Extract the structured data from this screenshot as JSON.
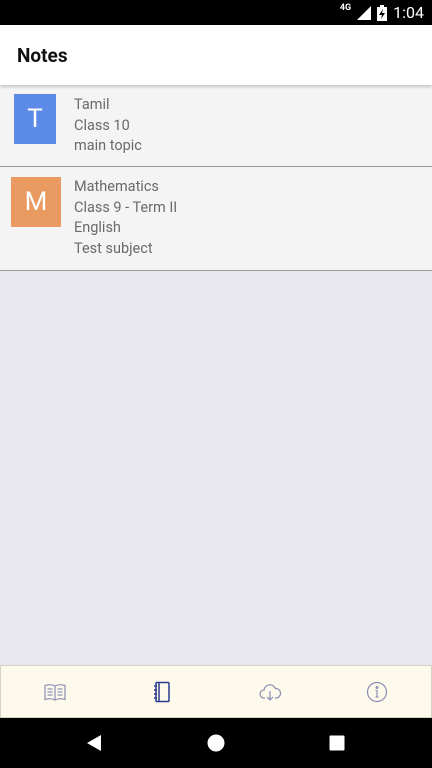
{
  "status_bar": {
    "network": "4G",
    "time": "1:04"
  },
  "app_bar": {
    "title": "Notes"
  },
  "notes": [
    {
      "initial": "T",
      "color": "#5b8be6",
      "lines": [
        "Tamil",
        "Class 10",
        "main topic"
      ]
    },
    {
      "initial": "M",
      "color": "#e89a60",
      "lines": [
        "Mathematics",
        "Class 9 - Term II",
        "English",
        "Test subject"
      ]
    }
  ],
  "bottom_nav": {
    "items": [
      {
        "icon": "book-icon",
        "active": false
      },
      {
        "icon": "notebook-icon",
        "active": true
      },
      {
        "icon": "cloud-download-icon",
        "active": false
      },
      {
        "icon": "info-icon",
        "active": false
      }
    ],
    "active_color": "#2d3a8c",
    "inactive_color": "#8a90b3"
  },
  "system_nav": {
    "icons": [
      "back-icon",
      "home-icon",
      "recents-icon"
    ]
  }
}
